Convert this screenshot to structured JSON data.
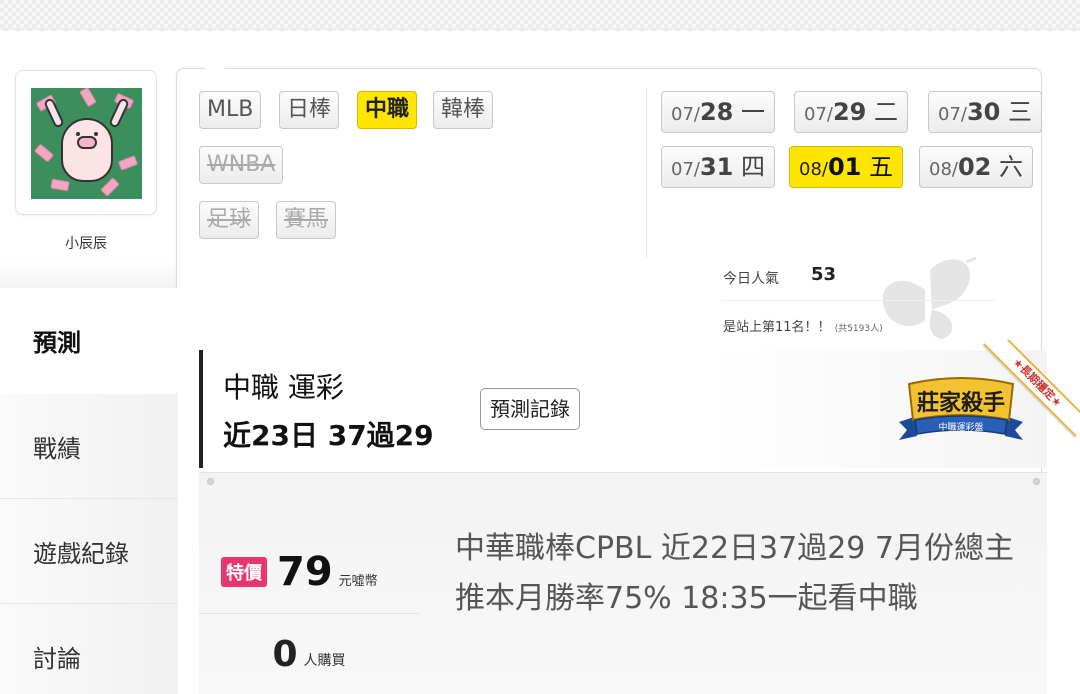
{
  "user": {
    "name": "小辰辰"
  },
  "nav": {
    "items": [
      {
        "label": "預測",
        "active": true
      },
      {
        "label": "戰績",
        "active": false
      },
      {
        "label": "遊戲紀錄",
        "active": false
      },
      {
        "label": "討論",
        "active": false
      }
    ]
  },
  "leagues": [
    {
      "label": "MLB",
      "state": "normal"
    },
    {
      "label": "日棒",
      "state": "normal"
    },
    {
      "label": "中職",
      "state": "active"
    },
    {
      "label": "韓棒",
      "state": "normal"
    },
    {
      "label": "WNBA",
      "state": "disabled"
    },
    {
      "label": "足球",
      "state": "disabled"
    },
    {
      "label": "賽馬",
      "state": "disabled"
    }
  ],
  "dates": [
    {
      "month": "07/",
      "day": "28",
      "dow": " 一",
      "active": false
    },
    {
      "month": "07/",
      "day": "29",
      "dow": " 二",
      "active": false
    },
    {
      "month": "07/",
      "day": "30",
      "dow": " 三",
      "active": false
    },
    {
      "month": "07/",
      "day": "31",
      "dow": " 四",
      "active": false
    },
    {
      "month": "08/",
      "day": "01",
      "dow": " 五",
      "active": true
    },
    {
      "month": "08/",
      "day": "02",
      "dow": " 六",
      "active": false
    }
  ],
  "popularity": {
    "label": "今日人氣",
    "value": "53",
    "rank_text": "是站上第11名！！",
    "rank_total": "(共5193人)"
  },
  "prediction": {
    "title": "中職 運彩",
    "record": "近23日 37過29",
    "history_button": "預測記錄",
    "badge_text": "莊家殺手",
    "badge_sub": "中職運彩盤",
    "ribbon_text": "★長期穩定★"
  },
  "item": {
    "special_label": "特價",
    "price": "79",
    "price_unit": "元噓幣",
    "buyers": "0",
    "buyers_unit": "人購買",
    "description": "中華職棒CPBL 近22日37過29 7月份總主推本月勝率75% 18:35一起看中職"
  },
  "colors": {
    "highlight": "#ffe600",
    "special": "#e8356d",
    "badge_gold": "#f2c230",
    "badge_blue": "#2a5fb8"
  }
}
